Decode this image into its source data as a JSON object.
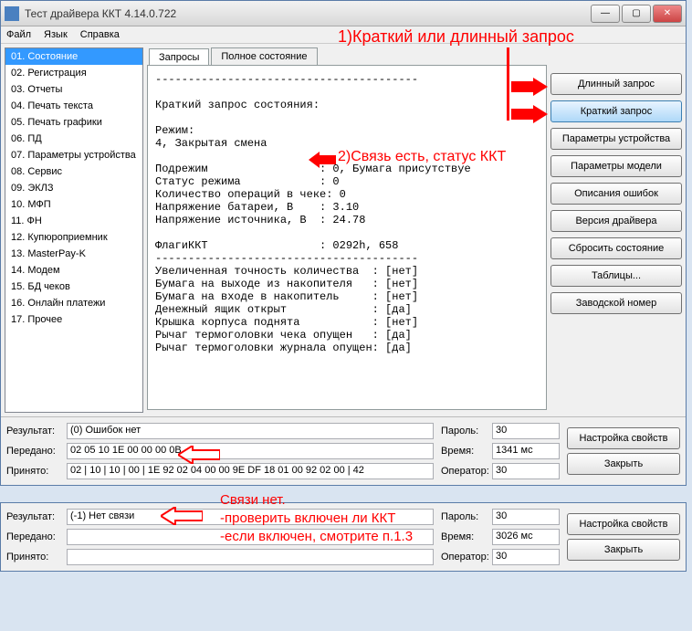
{
  "window": {
    "title": "Тест драйвера ККТ 4.14.0.722"
  },
  "menu": {
    "file": "Файл",
    "lang": "Язык",
    "help": "Справка"
  },
  "annotations": {
    "top": "1)Краткий или длинный запрос",
    "status": "2)Связь есть, статус ККТ",
    "bottom1": "Связи нет.",
    "bottom2": "-проверить включен ли ККТ",
    "bottom3": "-если включен, смотрите п.1.3"
  },
  "sidebar": {
    "items": [
      "01. Состояние",
      "02. Регистрация",
      "03. Отчеты",
      "04. Печать текста",
      "05. Печать графики",
      "06. ПД",
      "07. Параметры устройства",
      "08. Сервис",
      "09. ЭКЛЗ",
      "10. МФП",
      "11. ФН",
      "12. Купюроприемник",
      "13. MasterPay-K",
      "14. Модем",
      "15. БД чеков",
      "16. Онлайн платежи",
      "17. Прочее"
    ]
  },
  "tabs": {
    "t1": "Запросы",
    "t2": "Полное состояние"
  },
  "mono": {
    "l1": "----------------------------------------",
    "l2": "",
    "l3": "Краткий запрос состояния:",
    "l4": "",
    "l5": "Режим:",
    "l6": "4, Закрытая смена",
    "l7": "",
    "l8": "Подрежим                 : 0, Бумага присутствуе",
    "l9": "Статус режима            : 0",
    "l10": "Количество операций в чеке: 0",
    "l11": "Напряжение батареи, В    : 3.10",
    "l12": "Напряжение источника, В  : 24.78",
    "l13": "",
    "l14": "ФлагиККТ                 : 0292h, 658",
    "l15": "----------------------------------------",
    "l16": "Увеличенная точность количества  : [нет]",
    "l17": "Бумага на выходе из накопителя   : [нет]",
    "l18": "Бумага на входе в накопитель     : [нет]",
    "l19": "Денежный ящик открыт             : [да]",
    "l20": "Крышка корпуса поднята           : [нет]",
    "l21": "Рычаг термоголовки чека опущен   : [да]",
    "l22": "Рычаг термоголовки журнала опущен: [да]"
  },
  "rightButtons": {
    "b1": "Длинный запрос",
    "b2": "Краткий запрос",
    "b3": "Параметры устройства",
    "b4": "Параметры модели",
    "b5": "Описания ошибок",
    "b6": "Версия драйвера",
    "b7": "Сбросить состояние",
    "b8": "Таблицы...",
    "b9": "Заводской номер"
  },
  "bottom1": {
    "resultLbl": "Результат:",
    "result": "(0) Ошибок нет",
    "sentLbl": "Передано:",
    "sent": "02 05 10 1E 00 00 00 0B",
    "recvLbl": "Принято:",
    "recv": "02 | 10 | 10 | 00 | 1E 92 02 04 00 00 9E DF 18 01 00 92 02 00 | 42",
    "passLbl": "Пароль:",
    "pass": "30",
    "timeLbl": "Время:",
    "time": "1341 мс",
    "opLbl": "Оператор:",
    "op": "30",
    "btnProps": "Настройка свойств",
    "btnClose": "Закрыть"
  },
  "bottom2": {
    "resultLbl": "Результат:",
    "result": "(-1) Нет связи",
    "sentLbl": "Передано:",
    "sent": "",
    "recvLbl": "Принято:",
    "recv": "",
    "passLbl": "Пароль:",
    "pass": "30",
    "timeLbl": "Время:",
    "time": "3026 мс",
    "opLbl": "Оператор:",
    "op": "30",
    "btnProps": "Настройка свойств",
    "btnClose": "Закрыть"
  }
}
